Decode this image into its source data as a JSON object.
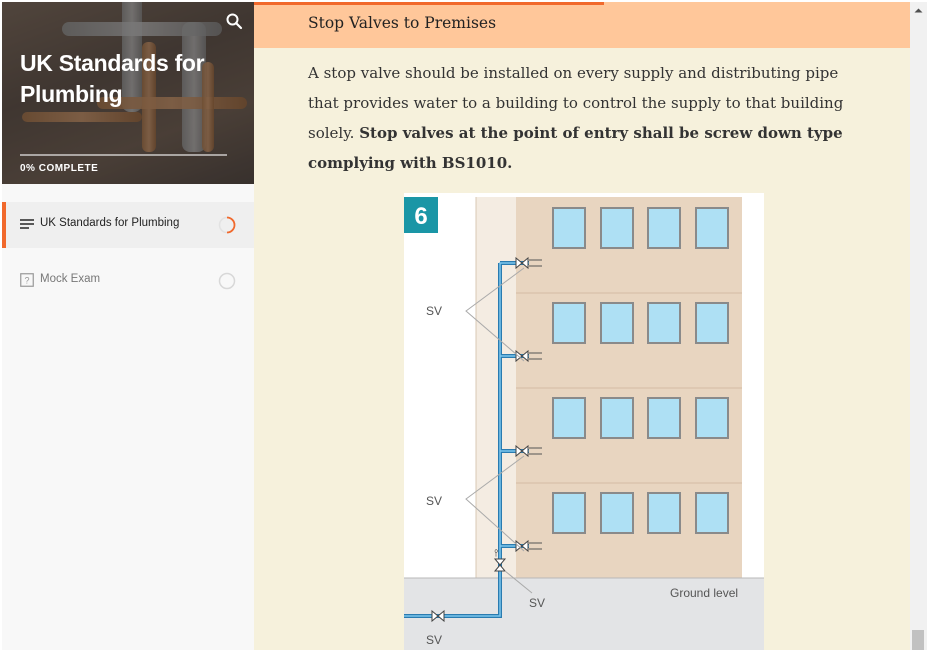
{
  "course": {
    "title": "UK Standards for Plumbing",
    "progress_percent": 0,
    "progress_label": "0% COMPLETE"
  },
  "sidebar": {
    "lessons": [
      {
        "label": "UK Standards for Plumbing",
        "icon": "lines-icon",
        "status": "in-progress"
      },
      {
        "label": "Mock Exam",
        "icon": "quiz-icon",
        "status": "not-started"
      }
    ]
  },
  "content": {
    "section_heading": "Stop Valves to Premises",
    "paragraph_normal": "A stop valve should be installed on every supply and distributing pipe that provides water to a building to control the supply to that building solely. ",
    "paragraph_bold": "Stop valves at the point of entry shall be screw down type complying with BS1010.",
    "figure": {
      "number": "6",
      "labels": [
        "SV",
        "SV",
        "SV",
        "SV"
      ],
      "ground_label": "Ground level"
    }
  },
  "colors": {
    "accent": "#f1692c",
    "banner": "#ffc79a",
    "content_bg": "#f6f1dc",
    "figure_teal": "#1a96a6",
    "building": "#e8d5c0",
    "window": "#aee0f4",
    "pipe": "#3aa0d8"
  }
}
